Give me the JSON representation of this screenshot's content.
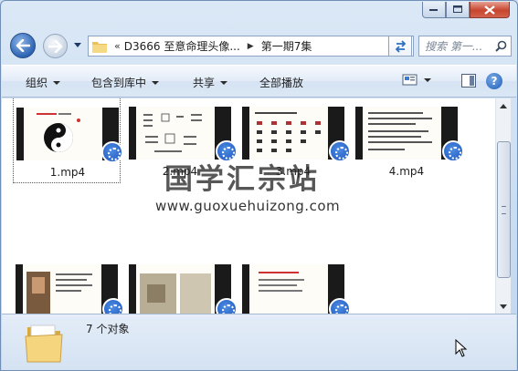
{
  "window": {
    "caption_buttons": [
      "minimize",
      "maximize",
      "close"
    ]
  },
  "address_bar": {
    "overflow": "«",
    "crumbs": [
      "D3666 至意命理头像...",
      "第一期7集"
    ]
  },
  "search": {
    "placeholder": "搜索 第一..."
  },
  "toolbar": {
    "organize": "组织",
    "include_library": "包含到库中",
    "share": "共享",
    "play_all": "全部播放",
    "help": "?"
  },
  "files": [
    {
      "name": "1.mp4"
    },
    {
      "name": "2.mp4"
    },
    {
      "name": "3.mp4"
    },
    {
      "name": "4.mp4"
    },
    {
      "name": ""
    },
    {
      "name": ""
    },
    {
      "name": ""
    }
  ],
  "watermark": {
    "title": "国学汇宗站",
    "url": "www.guoxuehuizong.com"
  },
  "status": {
    "count_text": "7 个对象"
  },
  "colors": {
    "accent": "#2d64b5",
    "play_badge": "#1c54b8",
    "selection": "#555555"
  },
  "icons": [
    "back-arrow-icon",
    "forward-arrow-icon",
    "folder-icon",
    "refresh-icon",
    "search-icon",
    "view-icon",
    "preview-pane-icon",
    "help-icon",
    "video-file-icon"
  ]
}
